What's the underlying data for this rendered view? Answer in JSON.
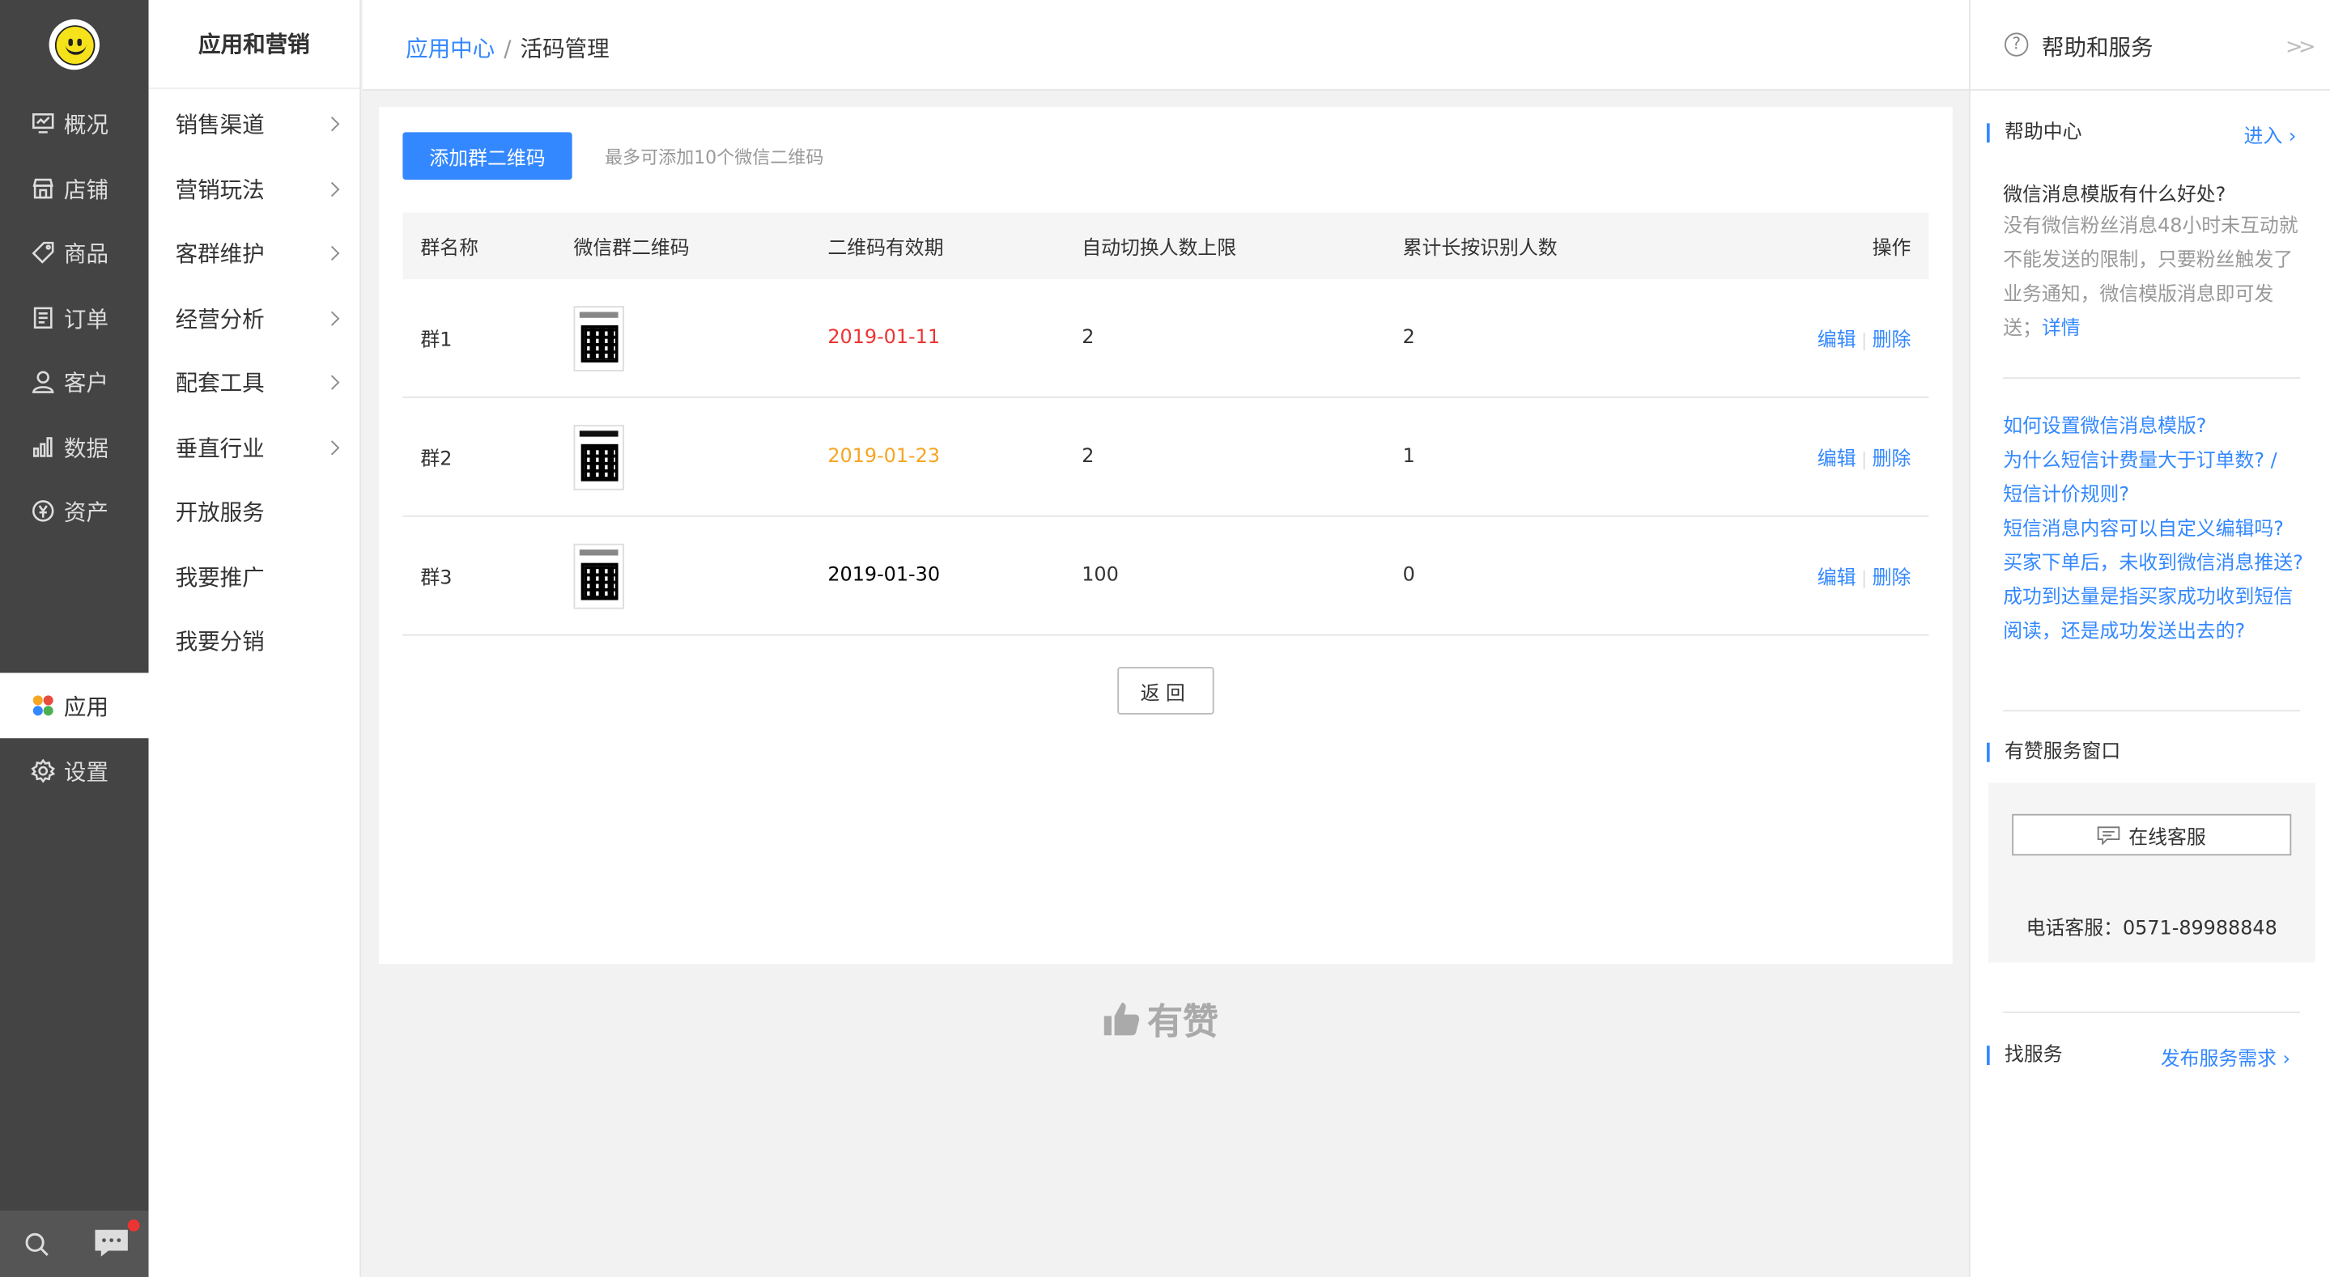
{
  "nav_primary": {
    "items": [
      {
        "label": "概况",
        "icon": "overview-icon"
      },
      {
        "label": "店铺",
        "icon": "store-icon"
      },
      {
        "label": "商品",
        "icon": "tag-icon"
      },
      {
        "label": "订单",
        "icon": "order-icon"
      },
      {
        "label": "客户",
        "icon": "user-icon"
      },
      {
        "label": "数据",
        "icon": "chart-icon"
      },
      {
        "label": "资产",
        "icon": "yuan-icon"
      },
      {
        "label": "应用",
        "icon": "apps-icon"
      },
      {
        "label": "设置",
        "icon": "gear-icon"
      }
    ],
    "active": "应用"
  },
  "nav_secondary": {
    "title": "应用和营销",
    "items": [
      {
        "label": "销售渠道",
        "has_arrow": true
      },
      {
        "label": "营销玩法",
        "has_arrow": true
      },
      {
        "label": "客群维护",
        "has_arrow": true
      },
      {
        "label": "经营分析",
        "has_arrow": true
      },
      {
        "label": "配套工具",
        "has_arrow": true
      },
      {
        "label": "垂直行业",
        "has_arrow": true
      },
      {
        "label": "开放服务",
        "has_arrow": false
      },
      {
        "label": "我要推广",
        "has_arrow": false
      },
      {
        "label": "我要分销",
        "has_arrow": false
      }
    ]
  },
  "breadcrumb": {
    "parent": "应用中心",
    "separator": "/",
    "current": "活码管理"
  },
  "main": {
    "add_button": "添加群二维码",
    "hint": "最多可添加10个微信二维码",
    "columns": [
      "群名称",
      "微信群二维码",
      "二维码有效期",
      "自动切换人数上限",
      "累计长按识别人数",
      "操作"
    ],
    "rows": [
      {
        "name": "群1",
        "expiry": "2019-01-11",
        "expiry_color": "#e33333",
        "limit": "2",
        "scans": "2"
      },
      {
        "name": "群2",
        "expiry": "2019-01-23",
        "expiry_color": "#f5a623",
        "limit": "2",
        "scans": "1"
      },
      {
        "name": "群3",
        "expiry": "2019-01-30",
        "expiry_color": "#000000",
        "limit": "100",
        "scans": "0"
      }
    ],
    "edit_label": "编辑",
    "delete_label": "删除",
    "back_button": "返回"
  },
  "brand_footer": "有赞",
  "right_panel": {
    "title": "帮助和服务",
    "help_center": {
      "title": "帮助中心",
      "enter": "进入",
      "question": "微信消息模版有什么好处?",
      "answer": "没有微信粉丝消息48小时未互动就不能发送的限制，只要粉丝触发了业务通知，微信模版消息即可发送；",
      "detail": "详情",
      "faq": [
        "如何设置微信消息模版?",
        "为什么短信计费量大于订单数? /",
        "短信计价规则?",
        "短信消息内容可以自定义编辑吗?",
        "买家下单后，未收到微信消息推送?",
        "成功到达量是指买家成功收到短信阅读，还是成功发送出去的?"
      ]
    },
    "service_window": {
      "title": "有赞服务窗口",
      "online": "在线客服",
      "phone": "电话客服：0571-89988848"
    },
    "find_service": {
      "title": "找服务",
      "link": "发布服务需求"
    }
  },
  "colors": {
    "accent": "#3388ff",
    "sidebar": "#444444"
  }
}
